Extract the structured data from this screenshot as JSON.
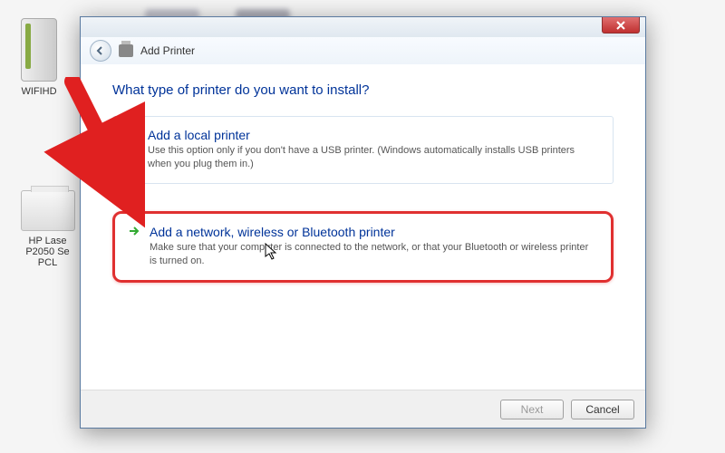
{
  "desktop": {
    "wifi_label": "WIFIHD",
    "printer_label": "HP Lase\nP2050 Se\nPCL"
  },
  "wizard": {
    "header_title": "Add Printer",
    "question": "What type of printer do you want to install?",
    "options": [
      {
        "title": "Add a local printer",
        "desc": "Use this option only if you don't have a USB printer. (Windows automatically installs USB printers when you plug them in.)"
      },
      {
        "title": "Add a network, wireless or Bluetooth printer",
        "desc": "Make sure that your computer is connected to the network, or that your Bluetooth or wireless printer is turned on."
      }
    ],
    "buttons": {
      "next": "Next",
      "cancel": "Cancel"
    }
  }
}
